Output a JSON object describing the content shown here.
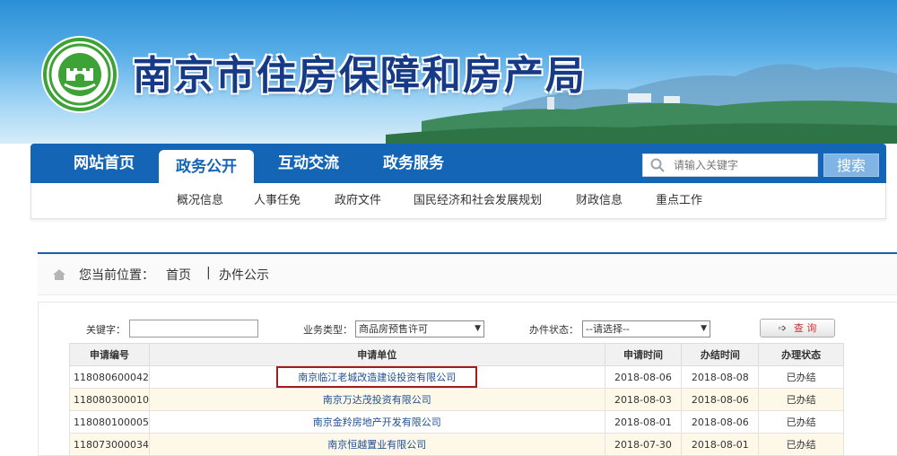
{
  "site": {
    "title": "南京市住房保障和房产局"
  },
  "nav": {
    "items": [
      {
        "label": "网站首页"
      },
      {
        "label": "政务公开",
        "active": true
      },
      {
        "label": "互动交流"
      },
      {
        "label": "政务服务"
      }
    ],
    "search_placeholder": "请输入关键字",
    "search_button": "搜索"
  },
  "subnav": {
    "items": [
      "概况信息",
      "人事任免",
      "政府文件",
      "国民经济和社会发展规划",
      "财政信息",
      "重点工作"
    ]
  },
  "breadcrumb": {
    "prefix": "您当前位置：",
    "home": "首页",
    "separator": "|",
    "current": "办件公示"
  },
  "filters": {
    "keyword_label": "关键字：",
    "keyword_value": "",
    "type_label": "业务类型：",
    "type_value": "商品房预售许可",
    "status_label": "办件状态：",
    "status_value": "--请选择--",
    "query_icon": "arrow-right-icon",
    "query_label": "查 询"
  },
  "table": {
    "headers": [
      "申请编号",
      "申请单位",
      "申请时间",
      "办结时间",
      "办理状态"
    ],
    "rows": [
      [
        "118080600042",
        "南京临江老城改造建设投资有限公司",
        "2018-08-06",
        "2018-08-08",
        "已办结"
      ],
      [
        "118080300010",
        "南京万达茂投资有限公司",
        "2018-08-03",
        "2018-08-06",
        "已办结"
      ],
      [
        "118080100005",
        "南京金羚房地产开发有限公司",
        "2018-08-01",
        "2018-08-06",
        "已办结"
      ],
      [
        "118073000034",
        "南京恒越置业有限公司",
        "2018-07-30",
        "2018-08-01",
        "已办结"
      ]
    ],
    "highlighted_row": 0
  },
  "colors": {
    "nav_blue": "#1565b7",
    "title_blue": "#173a86",
    "highlight_red": "#a31d1d",
    "logo_green": "#3ea336"
  }
}
